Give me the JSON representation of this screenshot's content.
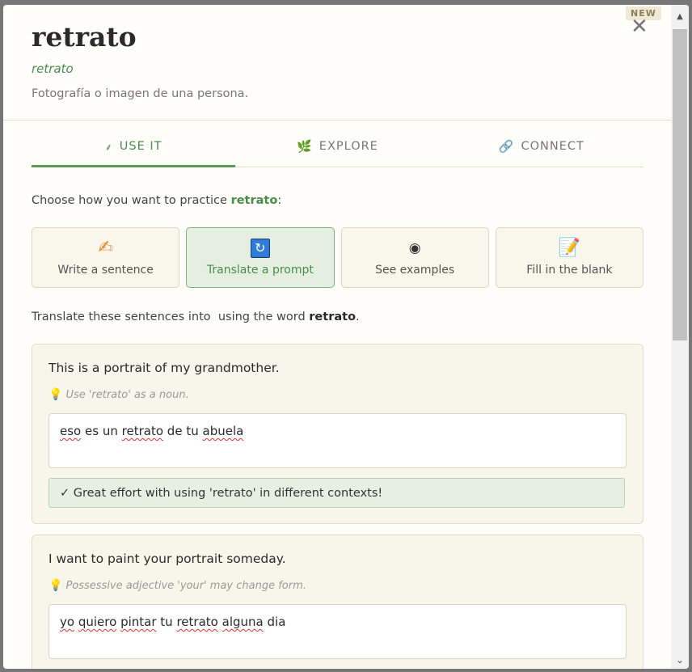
{
  "header": {
    "badge": "NEW",
    "close_glyph": "✕",
    "word": "retrato",
    "transliteration": "retrato",
    "definition": "Fotografía o imagen de una persona."
  },
  "tabs": [
    {
      "label": "USE IT",
      "icon": "sprout-icon",
      "glyph": "⸙",
      "active": true
    },
    {
      "label": "EXPLORE",
      "icon": "leaf-icon",
      "glyph": "🌿",
      "active": false
    },
    {
      "label": "CONNECT",
      "icon": "link-icon",
      "glyph": "🔗",
      "active": false
    }
  ],
  "practice": {
    "prompt_prefix": "Choose how you want to practice ",
    "word": "retrato",
    "prompt_suffix": ":",
    "modes": [
      {
        "label": "Write a sentence",
        "icon": "pencil-icon",
        "glyph": "✍",
        "active": false
      },
      {
        "label": "Translate a prompt",
        "icon": "refresh-icon",
        "glyph": "🔄",
        "active": true
      },
      {
        "label": "See examples",
        "icon": "eye-icon",
        "glyph": "👁",
        "active": false
      },
      {
        "label": "Fill in the blank",
        "icon": "memo-icon",
        "glyph": "📝",
        "active": false
      }
    ]
  },
  "instructions": {
    "prefix": "Translate these sentences into  using the word ",
    "word": "retrato",
    "suffix": "."
  },
  "exercises": [
    {
      "sentence": "This is a portrait of my grandmother.",
      "hint": "Use 'retrato' as a noun.",
      "answer_words": [
        "eso",
        "es",
        "un",
        "retrato",
        "de",
        "tu",
        "abuela"
      ],
      "misspelled": [
        "eso",
        "retrato",
        "abuela"
      ],
      "feedback": "✓ Great effort with using 'retrato' in different contexts!"
    },
    {
      "sentence": "I want to paint your portrait someday.",
      "hint": "Possessive adjective 'your' may change form.",
      "answer_words": [
        "yo",
        "quiero",
        "pintar",
        "tu",
        "retrato",
        "alguna",
        "dia"
      ],
      "misspelled": [
        "yo",
        "quiero",
        "pintar",
        "retrato",
        "alguna"
      ],
      "feedback": ""
    }
  ],
  "colors": {
    "accent": "#4a8c4a",
    "card_bg": "#f8f5ea",
    "active_mode_bg": "#e4efe2"
  }
}
